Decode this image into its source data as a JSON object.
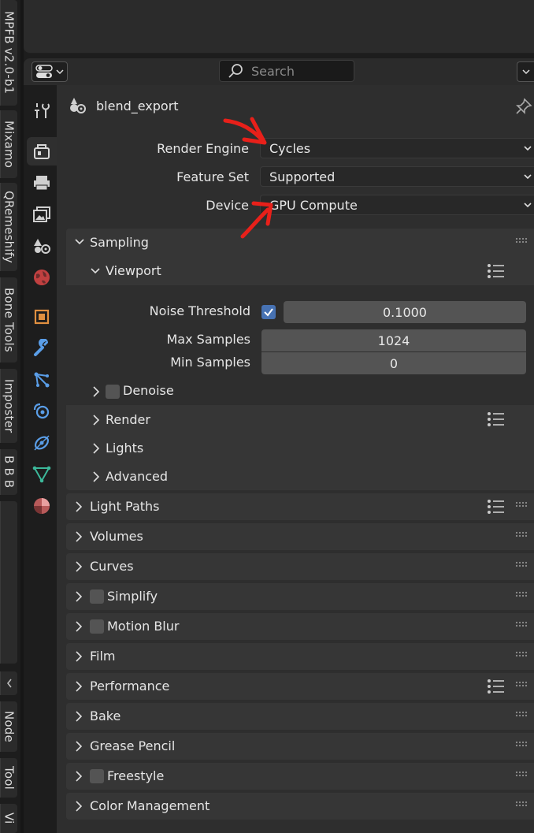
{
  "side_tabs": [
    {
      "label": "MPFB v2.0-b1"
    },
    {
      "label": "Mixamo"
    },
    {
      "label": "QRemeshify"
    },
    {
      "label": "Bone Tools"
    },
    {
      "label": "Imposter"
    },
    {
      "label": "B B B"
    },
    {
      "label": "Node"
    },
    {
      "label": "Tool"
    },
    {
      "label": "Vi"
    }
  ],
  "header": {
    "search_placeholder": "Search"
  },
  "properties_tabs": [
    {
      "icon": "tool-icon"
    },
    {
      "icon": "render-icon",
      "active": true
    },
    {
      "icon": "output-icon"
    },
    {
      "icon": "view-layer-icon"
    },
    {
      "icon": "scene-icon"
    },
    {
      "icon": "world-icon"
    },
    {
      "icon": "object-icon"
    },
    {
      "icon": "modifier-icon"
    },
    {
      "icon": "particles-icon"
    },
    {
      "icon": "physics-icon"
    },
    {
      "icon": "constraints-icon"
    },
    {
      "icon": "data-icon"
    },
    {
      "icon": "material-icon"
    }
  ],
  "context": {
    "name": "blend_export"
  },
  "render_engine": {
    "label": "Render Engine",
    "value": "Cycles"
  },
  "feature_set": {
    "label": "Feature Set",
    "value": "Supported"
  },
  "device": {
    "label": "Device",
    "value": "GPU Compute"
  },
  "sampling": {
    "title": "Sampling",
    "viewport": {
      "title": "Viewport",
      "noise_threshold_label": "Noise Threshold",
      "noise_threshold_enabled": true,
      "noise_threshold_value": "0.1000",
      "max_samples_label": "Max Samples",
      "max_samples_value": "1024",
      "min_samples_label": "Min Samples",
      "min_samples_value": "0",
      "denoise_label": "Denoise"
    },
    "render": "Render",
    "lights": "Lights",
    "advanced": "Advanced"
  },
  "panels": {
    "light_paths": "Light Paths",
    "volumes": "Volumes",
    "curves": "Curves",
    "simplify": "Simplify",
    "motion_blur": "Motion Blur",
    "film": "Film",
    "performance": "Performance",
    "bake": "Bake",
    "grease_pencil": "Grease Pencil",
    "freestyle": "Freestyle",
    "color_management": "Color Management"
  },
  "colors": {
    "accent": "#4772b3",
    "annotation": "#e8201a"
  }
}
